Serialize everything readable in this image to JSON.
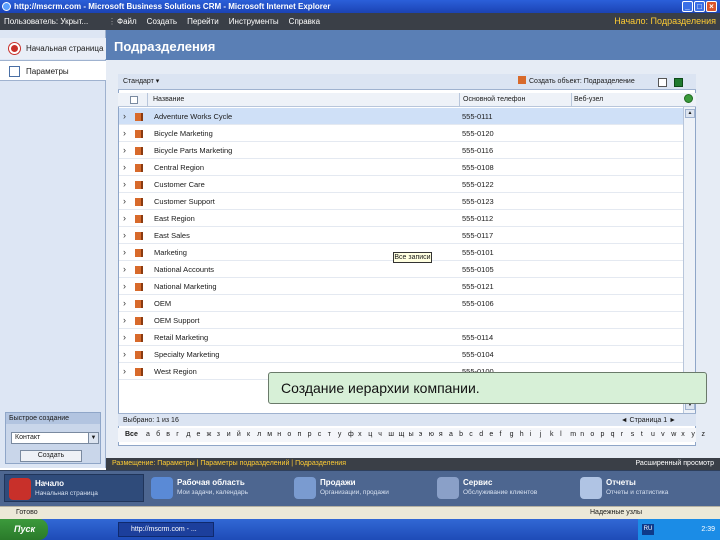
{
  "window": {
    "title": "http://mscrm.com - Microsoft Business Solutions CRM - Microsoft Internet Explorer"
  },
  "crm_bar": {
    "user": "Пользователь: Укрыт...",
    "menu": [
      "Файл",
      "Создать",
      "Перейти",
      "Инструменты",
      "Справка"
    ],
    "home_label": "Начало: Подразделения"
  },
  "nav": {
    "items": [
      {
        "label": "Начальная страница"
      },
      {
        "label": "Параметры"
      }
    ],
    "quick_create": {
      "title": "Быстрое создание",
      "selected": "Контакт",
      "button": "Создать"
    }
  },
  "page": {
    "title": "Подразделения"
  },
  "grid": {
    "views_label": "Стандарт ▾",
    "create_label": "Создать объект: Подразделение",
    "columns": [
      "Название",
      "Основной телефон",
      "Веб-узел"
    ],
    "rows": [
      {
        "name": "Adventure Works Cycle",
        "phone": "555-0111"
      },
      {
        "name": "Bicycle Marketing",
        "phone": "555-0120"
      },
      {
        "name": "Bicycle Parts Marketing",
        "phone": "555-0116"
      },
      {
        "name": "Central Region",
        "phone": "555-0108"
      },
      {
        "name": "Customer Care",
        "phone": "555-0122"
      },
      {
        "name": "Customer Support",
        "phone": "555-0123"
      },
      {
        "name": "East Region",
        "phone": "555-0112"
      },
      {
        "name": "East Sales",
        "phone": "555-0117"
      },
      {
        "name": "Marketing",
        "phone": "555-0101"
      },
      {
        "name": "National Accounts",
        "phone": "555-0105"
      },
      {
        "name": "National Marketing",
        "phone": "555-0121"
      },
      {
        "name": "OEM",
        "phone": "555-0106"
      },
      {
        "name": "OEM Support",
        "phone": ""
      },
      {
        "name": "Retail Marketing",
        "phone": "555-0114"
      },
      {
        "name": "Specialty Marketing",
        "phone": "555-0104"
      },
      {
        "name": "West Region",
        "phone": "555-0100"
      }
    ],
    "footer_left": "Выбрано: 1 из 16",
    "footer_right": "◄ Страница 1 ►",
    "alphabet": [
      "Все",
      "а",
      "б",
      "в",
      "г",
      "д",
      "е",
      "ж",
      "з",
      "и",
      "й",
      "к",
      "л",
      "м",
      "н",
      "о",
      "п",
      "р",
      "с",
      "т",
      "у",
      "ф",
      "х",
      "ц",
      "ч",
      "ш",
      "щ",
      "ы",
      "э",
      "ю",
      "я",
      "a",
      "b",
      "c",
      "d",
      "e",
      "f",
      "g",
      "h",
      "i",
      "j",
      "k",
      "l",
      "m",
      "n",
      "o",
      "p",
      "q",
      "r",
      "s",
      "t",
      "u",
      "v",
      "w",
      "x",
      "y",
      "z"
    ]
  },
  "tooltip": "Все записи",
  "caption": "Создание иерархии компании.",
  "status_line": {
    "breadcrumb": "Размещение: Параметры | Параметры подразделений | Подразделения",
    "advanced": "Расширенный просмотр"
  },
  "modules": [
    {
      "title": "Начало",
      "subtitle": "Начальная страница",
      "color": "#c8302a"
    },
    {
      "title": "Рабочая область",
      "subtitle": "Мои задачи, календарь",
      "color": "#5a8ad6"
    },
    {
      "title": "Продажи",
      "subtitle": "Организации, продажи",
      "color": "#7a9bd0"
    },
    {
      "title": "Сервис",
      "subtitle": "Обслуживание клиентов",
      "color": "#8aa0c8"
    },
    {
      "title": "Отчеты",
      "subtitle": "Отчеты и статистика",
      "color": "#b0c4e4"
    }
  ],
  "ie_status": {
    "done": "Готово",
    "zone": "Надежные узлы"
  },
  "taskbar": {
    "start": "Пуск",
    "app": "http://mscrm.com - ...",
    "lang": "RU",
    "time": "2:39"
  }
}
